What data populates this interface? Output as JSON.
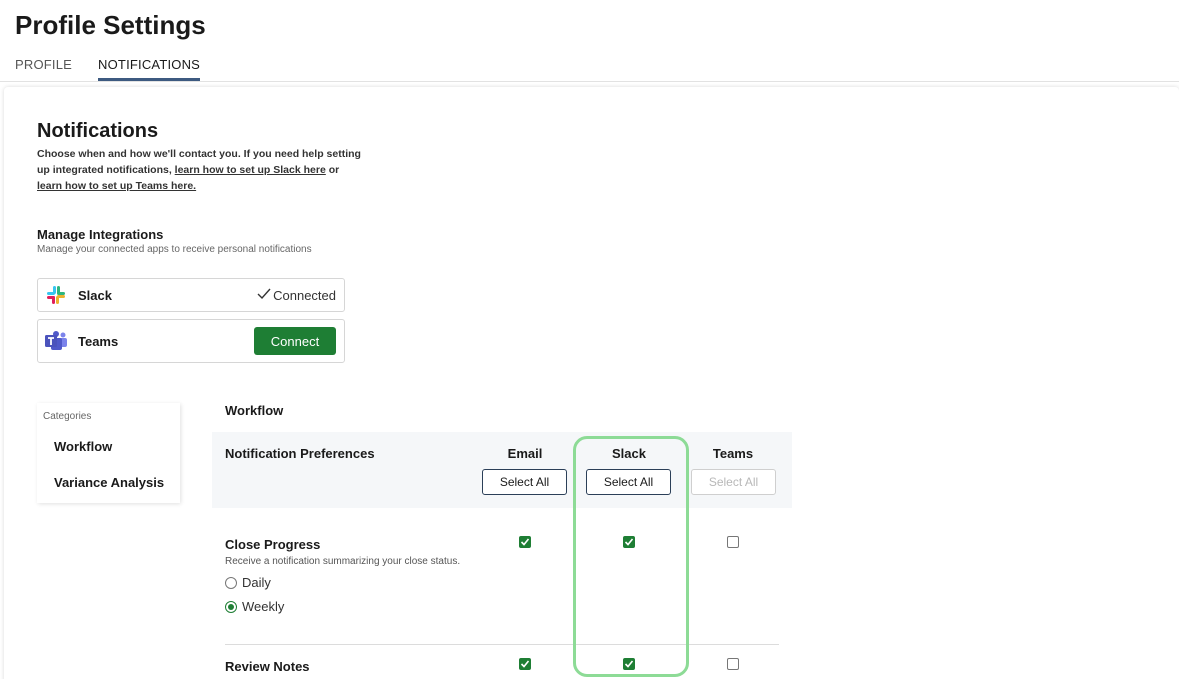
{
  "page": {
    "title": "Profile Settings"
  },
  "tabs": [
    {
      "label": "PROFILE",
      "active": false
    },
    {
      "label": "NOTIFICATIONS",
      "active": true
    }
  ],
  "notifications": {
    "title": "Notifications",
    "desc_text1": "Choose when and how we'll contact you. If you need help setting up integrated notifications, ",
    "slack_link": "learn how to set up Slack here",
    "desc_or": " or ",
    "teams_link": "learn how to set up Teams here."
  },
  "integrations": {
    "title": "Manage Integrations",
    "desc": "Manage your connected apps to receive personal notifications",
    "slack": {
      "name": "Slack",
      "status": "Connected",
      "icon": "slack-icon"
    },
    "teams": {
      "name": "Teams",
      "action": "Connect",
      "icon": "teams-icon"
    }
  },
  "categories": {
    "label": "Categories",
    "items": [
      "Workflow",
      "Variance Analysis"
    ]
  },
  "workflow": {
    "title": "Workflow",
    "header": "Notification Preferences",
    "columns": [
      {
        "name": "Email",
        "select_all": "Select All",
        "disabled": false
      },
      {
        "name": "Slack",
        "select_all": "Select All",
        "disabled": false
      },
      {
        "name": "Teams",
        "select_all": "Select All",
        "disabled": true
      }
    ],
    "rows": [
      {
        "title": "Close Progress",
        "desc": "Receive a notification summarizing your close status.",
        "frequency": [
          {
            "label": "Daily",
            "selected": false
          },
          {
            "label": "Weekly",
            "selected": true
          }
        ],
        "email": true,
        "slack": true,
        "teams": false
      },
      {
        "title": "Review Notes",
        "email": true,
        "slack": true,
        "teams": false
      }
    ]
  },
  "colors": {
    "accent_green": "#1e7e34",
    "tab_underline": "#3d5a80",
    "highlight": "#8ddb96"
  }
}
